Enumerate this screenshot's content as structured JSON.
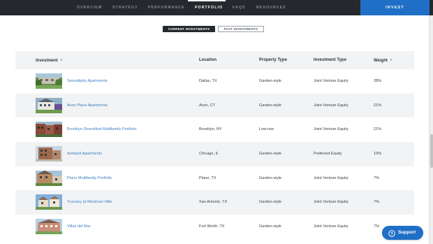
{
  "nav": {
    "items": [
      "OVERVIEW",
      "STRATEGY",
      "PERFORMANCE",
      "PORTFOLIO",
      "FAQS",
      "RESOURCES"
    ],
    "active": "PORTFOLIO",
    "invest_label": "INVEST"
  },
  "toggle": {
    "current_label": "CURRENT INVESTMENTS",
    "past_label": "PAST INVESTMENTS"
  },
  "table": {
    "headers": {
      "investment": "Investment",
      "location": "Location",
      "property_type": "Property Type",
      "investment_type": "Investment Type",
      "weight": "Weight"
    },
    "rows": [
      {
        "name": "Serendipity Apartments",
        "location": "Dallas, TX",
        "property_type": "Garden-style",
        "investment_type": "Joint Venture Equity",
        "weight": "28%"
      },
      {
        "name": "Avon Place Apartments",
        "location": "Avon, CT",
        "property_type": "Garden-style",
        "investment_type": "Joint Venture Equity",
        "weight": "21%"
      },
      {
        "name": "Brooklyn Diversified Multifamily Portfolio",
        "location": "Brooklyn, NY",
        "property_type": "Low-rise",
        "investment_type": "Joint Venture Equity",
        "weight": "21%"
      },
      {
        "name": "Ashland Apartments",
        "location": "Chicago, IL",
        "property_type": "Garden-style",
        "investment_type": "Preferred Equity",
        "weight": "10%"
      },
      {
        "name": "Plano Multifamily Portfolio",
        "location": "Plano, TX",
        "property_type": "Garden-style",
        "investment_type": "Joint Venture Equity",
        "weight": "7%"
      },
      {
        "name": "Tuscany at Westover Hills",
        "location": "San Antonio, TX",
        "property_type": "Garden-style",
        "investment_type": "Joint Venture Equity",
        "weight": "7%"
      },
      {
        "name": "Villas del Mar",
        "location": "Fort Worth, TX",
        "property_type": "Garden-style",
        "investment_type": "Joint Venture Equity",
        "weight": "7%"
      }
    ]
  },
  "support": {
    "label": "Support",
    "icon": "help-icon"
  },
  "colors": {
    "nav_bg": "#25282c",
    "accent": "#1f6fc6",
    "link": "#3b7fc4",
    "row_alt": "#f2f3f4"
  }
}
